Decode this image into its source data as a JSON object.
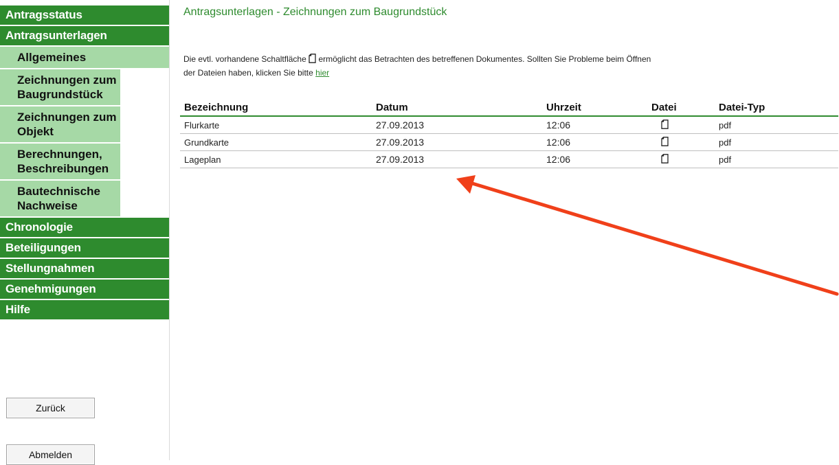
{
  "sidebar": {
    "items": [
      {
        "label": "Antragsstatus",
        "type": "main"
      },
      {
        "label": "Antragsunterlagen",
        "type": "main"
      },
      {
        "label": "Allgemeines",
        "type": "sub"
      },
      {
        "label": "Zeichnungen zum Baugrundstück",
        "type": "sub"
      },
      {
        "label": "Zeichnungen zum Objekt",
        "type": "sub"
      },
      {
        "label": "Berechnungen, Beschreibungen",
        "type": "sub"
      },
      {
        "label": "Bautechnische Nachweise",
        "type": "sub"
      },
      {
        "label": "Chronologie",
        "type": "main"
      },
      {
        "label": "Beteiligungen",
        "type": "main"
      },
      {
        "label": "Stellungnahmen",
        "type": "main"
      },
      {
        "label": "Genehmigungen",
        "type": "main"
      },
      {
        "label": "Hilfe",
        "type": "main"
      }
    ],
    "back_button": "Zurück",
    "logout_button": "Abmelden"
  },
  "main": {
    "title": "Antragsunterlagen - Zeichnungen zum Baugrundstück",
    "info_part1": "Die evtl. vorhandene Schaltfläche",
    "info_part2": "ermöglicht das Betrachten des betreffenen Dokumentes. Sollten Sie Probleme beim Öffnen",
    "info_part3": "der Dateien haben, klicken Sie bitte",
    "info_link": "hier",
    "table": {
      "headers": [
        "Bezeichnung",
        "Datum",
        "Uhrzeit",
        "Datei",
        "Datei-Typ"
      ],
      "rows": [
        {
          "bezeichnung": "Flurkarte",
          "datum": "27.09.2013",
          "uhrzeit": "12:06",
          "typ": "pdf"
        },
        {
          "bezeichnung": "Grundkarte",
          "datum": "27.09.2013",
          "uhrzeit": "12:06",
          "typ": "pdf"
        },
        {
          "bezeichnung": "Lageplan",
          "datum": "27.09.2013",
          "uhrzeit": "12:06",
          "typ": "pdf"
        }
      ]
    }
  },
  "icons": {
    "file": "document-icon",
    "annotation": "red-arrow-annotation"
  },
  "colors": {
    "nav_main_bg": "#2e8b2e",
    "nav_sub_bg": "#a6d9a6",
    "accent": "#2e8b2e",
    "arrow": "#f0401a"
  }
}
